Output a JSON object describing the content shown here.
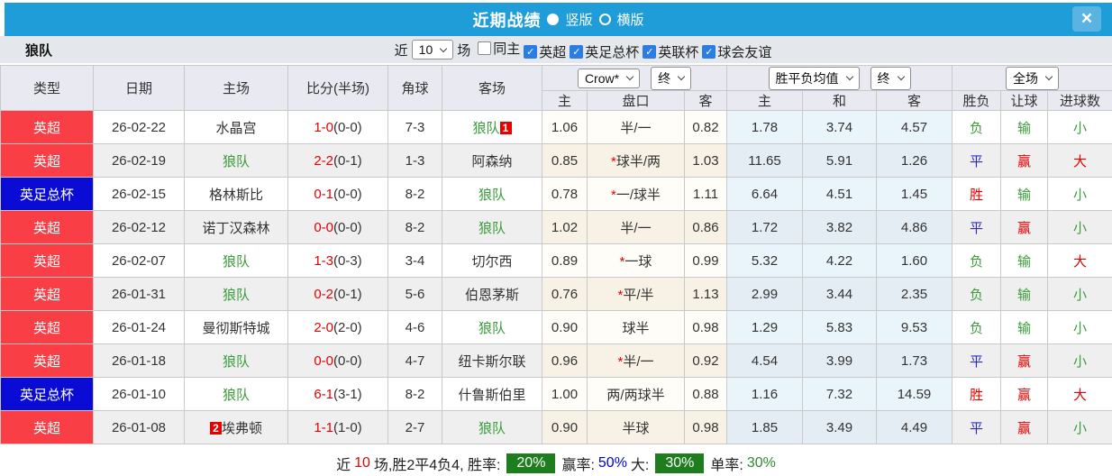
{
  "titlebar": {
    "title": "近期战绩",
    "layout_options": [
      {
        "label": "竖版",
        "selected": true
      },
      {
        "label": "横版",
        "selected": false
      }
    ],
    "close_label": "×"
  },
  "filterbar": {
    "team": "狼队",
    "near_label": "近",
    "count_value": "10",
    "matches_label": "场",
    "checkboxes": [
      {
        "label": "同主",
        "checked": false
      },
      {
        "label": "英超",
        "checked": true
      },
      {
        "label": "英足总杯",
        "checked": true
      },
      {
        "label": "英联杯",
        "checked": true
      },
      {
        "label": "球会友谊",
        "checked": true
      }
    ]
  },
  "table": {
    "selects": {
      "company": "Crow*",
      "company_time": "终",
      "avg": "胜平负均值",
      "avg_time": "终",
      "scope": "全场"
    },
    "columns": {
      "type": "类型",
      "date": "日期",
      "home": "主场",
      "score": "比分(半场)",
      "corners": "角球",
      "away": "客场",
      "odds_home": "主",
      "handicap": "盘口",
      "odds_away": "客",
      "avg_home": "主",
      "avg_draw": "和",
      "avg_away": "客",
      "result": "胜负",
      "handicap_result": "让球",
      "goals": "进球数"
    },
    "rows": [
      {
        "league": "英超",
        "league_color": "red",
        "date": "26-02-22",
        "home": "水晶宫",
        "home_green": false,
        "home_badge": "",
        "score_ft": "1-0",
        "score_ht": "(0-0)",
        "corners": "7-3",
        "away": "狼队",
        "away_green": true,
        "away_badge": "1",
        "odds_home": "1.06",
        "handicap": "半/一",
        "handicap_star": false,
        "odds_away": "0.82",
        "avg_home": "1.78",
        "avg_draw": "3.74",
        "avg_away": "4.57",
        "result": "负",
        "result_color": "green",
        "handicap_result": "输",
        "handicap_result_color": "green",
        "goals": "小",
        "goals_color": "green"
      },
      {
        "league": "英超",
        "league_color": "red",
        "date": "26-02-19",
        "home": "狼队",
        "home_green": true,
        "home_badge": "",
        "score_ft": "2-2",
        "score_ht": "(0-1)",
        "corners": "1-3",
        "away": "阿森纳",
        "away_green": false,
        "away_badge": "",
        "odds_home": "0.85",
        "handicap": "球半/两",
        "handicap_star": true,
        "odds_away": "1.03",
        "avg_home": "11.65",
        "avg_draw": "5.91",
        "avg_away": "1.26",
        "result": "平",
        "result_color": "blue",
        "handicap_result": "赢",
        "handicap_result_color": "red",
        "goals": "大",
        "goals_color": "red"
      },
      {
        "league": "英足总杯",
        "league_color": "blue",
        "date": "26-02-15",
        "home": "格林斯比",
        "home_green": false,
        "home_badge": "",
        "score_ft": "0-1",
        "score_ht": "(0-0)",
        "corners": "8-2",
        "away": "狼队",
        "away_green": true,
        "away_badge": "",
        "odds_home": "0.78",
        "handicap": "一/球半",
        "handicap_star": true,
        "odds_away": "1.11",
        "avg_home": "6.64",
        "avg_draw": "4.51",
        "avg_away": "1.45",
        "result": "胜",
        "result_color": "red",
        "handicap_result": "输",
        "handicap_result_color": "green",
        "goals": "小",
        "goals_color": "green"
      },
      {
        "league": "英超",
        "league_color": "red",
        "date": "26-02-12",
        "home": "诺丁汉森林",
        "home_green": false,
        "home_badge": "",
        "score_ft": "0-0",
        "score_ht": "(0-0)",
        "corners": "8-2",
        "away": "狼队",
        "away_green": true,
        "away_badge": "",
        "odds_home": "1.02",
        "handicap": "半/一",
        "handicap_star": false,
        "odds_away": "0.86",
        "avg_home": "1.72",
        "avg_draw": "3.82",
        "avg_away": "4.86",
        "result": "平",
        "result_color": "blue",
        "handicap_result": "赢",
        "handicap_result_color": "red",
        "goals": "小",
        "goals_color": "green"
      },
      {
        "league": "英超",
        "league_color": "red",
        "date": "26-02-07",
        "home": "狼队",
        "home_green": true,
        "home_badge": "",
        "score_ft": "1-3",
        "score_ht": "(0-3)",
        "corners": "3-4",
        "away": "切尔西",
        "away_green": false,
        "away_badge": "",
        "odds_home": "0.89",
        "handicap": "一球",
        "handicap_star": true,
        "odds_away": "0.99",
        "avg_home": "5.32",
        "avg_draw": "4.22",
        "avg_away": "1.60",
        "result": "负",
        "result_color": "green",
        "handicap_result": "输",
        "handicap_result_color": "green",
        "goals": "大",
        "goals_color": "red"
      },
      {
        "league": "英超",
        "league_color": "red",
        "date": "26-01-31",
        "home": "狼队",
        "home_green": true,
        "home_badge": "",
        "score_ft": "0-2",
        "score_ht": "(0-1)",
        "corners": "5-6",
        "away": "伯恩茅斯",
        "away_green": false,
        "away_badge": "",
        "odds_home": "0.76",
        "handicap": "平/半",
        "handicap_star": true,
        "odds_away": "1.13",
        "avg_home": "2.99",
        "avg_draw": "3.44",
        "avg_away": "2.35",
        "result": "负",
        "result_color": "green",
        "handicap_result": "输",
        "handicap_result_color": "green",
        "goals": "小",
        "goals_color": "green"
      },
      {
        "league": "英超",
        "league_color": "red",
        "date": "26-01-24",
        "home": "曼彻斯特城",
        "home_green": false,
        "home_badge": "",
        "score_ft": "2-0",
        "score_ht": "(2-0)",
        "corners": "4-6",
        "away": "狼队",
        "away_green": true,
        "away_badge": "",
        "odds_home": "0.90",
        "handicap": "球半",
        "handicap_star": false,
        "odds_away": "0.98",
        "avg_home": "1.29",
        "avg_draw": "5.83",
        "avg_away": "9.53",
        "result": "负",
        "result_color": "green",
        "handicap_result": "输",
        "handicap_result_color": "green",
        "goals": "小",
        "goals_color": "green"
      },
      {
        "league": "英超",
        "league_color": "red",
        "date": "26-01-18",
        "home": "狼队",
        "home_green": true,
        "home_badge": "",
        "score_ft": "0-0",
        "score_ht": "(0-0)",
        "corners": "4-7",
        "away": "纽卡斯尔联",
        "away_green": false,
        "away_badge": "",
        "odds_home": "0.96",
        "handicap": "半/一",
        "handicap_star": true,
        "odds_away": "0.92",
        "avg_home": "4.54",
        "avg_draw": "3.99",
        "avg_away": "1.73",
        "result": "平",
        "result_color": "blue",
        "handicap_result": "赢",
        "handicap_result_color": "red",
        "goals": "小",
        "goals_color": "green"
      },
      {
        "league": "英足总杯",
        "league_color": "blue",
        "date": "26-01-10",
        "home": "狼队",
        "home_green": true,
        "home_badge": "",
        "score_ft": "6-1",
        "score_ht": "(3-1)",
        "corners": "8-2",
        "away": "什鲁斯伯里",
        "away_green": false,
        "away_badge": "",
        "odds_home": "1.00",
        "handicap": "两/两球半",
        "handicap_star": false,
        "odds_away": "0.88",
        "avg_home": "1.16",
        "avg_draw": "7.32",
        "avg_away": "14.59",
        "result": "胜",
        "result_color": "red",
        "handicap_result": "赢",
        "handicap_result_color": "red",
        "goals": "大",
        "goals_color": "red"
      },
      {
        "league": "英超",
        "league_color": "red",
        "date": "26-01-08",
        "home": "埃弗顿",
        "home_green": false,
        "home_badge": "2",
        "score_ft": "1-1",
        "score_ht": "(1-0)",
        "corners": "2-7",
        "away": "狼队",
        "away_green": true,
        "away_badge": "",
        "odds_home": "0.90",
        "handicap": "半球",
        "handicap_star": false,
        "odds_away": "0.98",
        "avg_home": "1.85",
        "avg_draw": "3.49",
        "avg_away": "4.49",
        "result": "平",
        "result_color": "blue",
        "handicap_result": "赢",
        "handicap_result_color": "red",
        "goals": "小",
        "goals_color": "green"
      }
    ]
  },
  "footer": {
    "prefix": "近",
    "count": "10",
    "summary": "场,胜2平4负4, 胜率:",
    "win_rate_badge": "20%",
    "win_label": "赢率:",
    "win_value": "50%",
    "big_label": "大:",
    "big_badge": "30%",
    "single_label": "单率:",
    "single_value": "30%"
  },
  "colors": {
    "titlebar_blue": "#1e9dd8",
    "league_red": "#fa3e45",
    "league_blue": "#0b0bd6",
    "score_red": "#e60000",
    "team_green": "#3a9c3a",
    "draw_blue": "#2a2ad0",
    "badge_green": "#1e7e1e"
  }
}
